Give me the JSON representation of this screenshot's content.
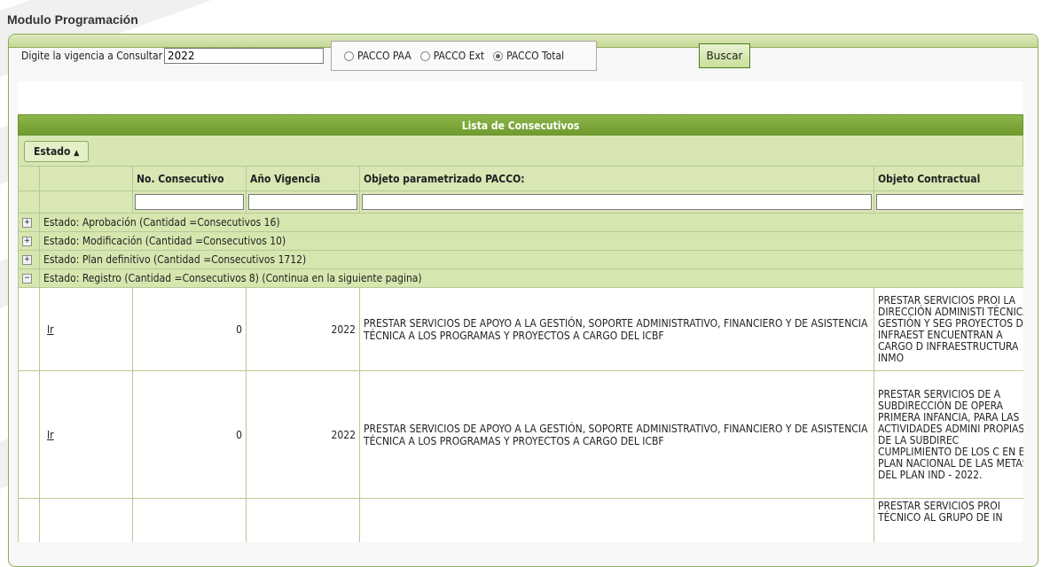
{
  "module_title": "Modulo Programación",
  "search": {
    "label": "Digite la vigencia a Consultar",
    "value": "2022",
    "options": [
      "PACCO PAA",
      "PACCO Ext",
      "PACCO Total"
    ],
    "selected": "PACCO Total",
    "button": "Buscar"
  },
  "grid": {
    "caption": "Lista de Consecutivos",
    "group_by": "Estado",
    "columns": [
      "No. Consecutivo",
      "Año Vigencia",
      "Objeto parametrizado PACCO:",
      "Objeto Contractual"
    ],
    "groups": [
      "Estado: Aprobación (Cantidad =Consecutivos 16)",
      "Estado: Modificación (Cantidad =Consecutivos 10)",
      "Estado: Plan definitivo (Cantidad =Consecutivos 1712)",
      "Estado: Registro (Cantidad =Consecutivos 8) (Continua en la siguiente pagina)"
    ],
    "rows": [
      {
        "link": "Ir",
        "consecutivo": "0",
        "vigencia": "2022",
        "objeto_pacco": "PRESTAR SERVICIOS DE APOYO A LA GESTIÓN, SOPORTE ADMINISTRATIVO, FINANCIERO Y DE ASISTENCIA TÉCNICA A LOS PROGRAMAS Y PROYECTOS A CARGO DEL ICBF",
        "objeto_contractual": "PRESTAR SERVICIOS PROI LA DIRECCIÓN ADMINISTI TÉCNICA, GESTIÓN Y SEG PROYECTOS DE INFRAEST ENCUENTRAN A CARGO D INFRAESTRUCTURA INMO"
      },
      {
        "link": "Ir",
        "consecutivo": "0",
        "vigencia": "2022",
        "objeto_pacco": "PRESTAR SERVICIOS DE APOYO A LA GESTIÓN, SOPORTE ADMINISTRATIVO, FINANCIERO Y DE ASISTENCIA TÉCNICA A LOS PROGRAMAS Y PROYECTOS A CARGO DEL ICBF",
        "objeto_contractual": "PRESTAR SERVICIOS DE A SUBDIRECCIÓN DE OPERA PRIMERA INFANCIA, PARA LAS ACTIVIDADES ADMINI PROPIAS DE LA SUBDIREC CUMPLIMIENTO DE LOS C EN EL PLAN NACIONAL DE LAS METAS DEL PLAN IND - 2022."
      },
      {
        "link": "",
        "consecutivo": "",
        "vigencia": "",
        "objeto_pacco": "",
        "objeto_contractual": "PRESTAR SERVICIOS PROI TÉCNICO AL GRUPO DE IN"
      }
    ]
  }
}
